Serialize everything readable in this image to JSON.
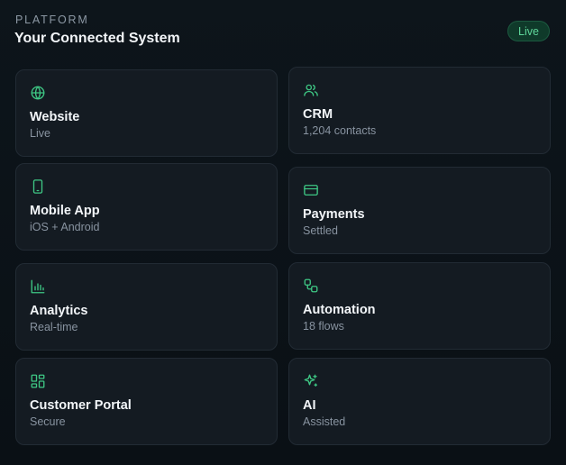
{
  "header": {
    "eyebrow": "PLATFORM",
    "title": "Your Connected System",
    "status_badge": "Live"
  },
  "colors": {
    "accent": "#3ec784",
    "badge_bg": "#0f3a2a",
    "badge_text": "#5fd69a",
    "card_bg": "#141b22",
    "page_bg": "#0a1116"
  },
  "cards": [
    {
      "name": "Website",
      "sub": "Live",
      "icon": "globe-icon"
    },
    {
      "name": "CRM",
      "sub": "1,204 contacts",
      "icon": "users-icon"
    },
    {
      "name": "Mobile App",
      "sub": "iOS + Android",
      "icon": "smartphone-icon"
    },
    {
      "name": "Payments",
      "sub": "Settled",
      "icon": "credit-card-icon"
    },
    {
      "name": "Analytics",
      "sub": "Real-time",
      "icon": "bar-chart-icon"
    },
    {
      "name": "Automation",
      "sub": "18 flows",
      "icon": "workflow-icon"
    },
    {
      "name": "Customer Portal",
      "sub": "Secure",
      "icon": "layout-grid-icon"
    },
    {
      "name": "AI",
      "sub": "Assisted",
      "icon": "sparkles-icon"
    }
  ]
}
